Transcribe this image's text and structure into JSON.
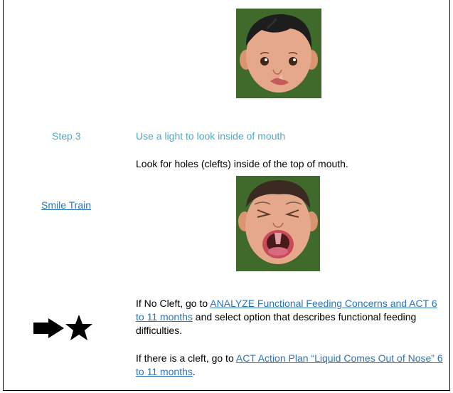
{
  "step": {
    "label": "Step 3",
    "instruction": "Use a light to look inside of mouth",
    "look_for": "Look for holes (clefts) inside of the top of mouth."
  },
  "link_smile_train": "Smile Train",
  "no_cleft": {
    "prefix": "If No Cleft, go to ",
    "link": "ANALYZE Functional Feeding Concerns and ACT 6 to 11 months",
    "suffix": " and select option that describes functional feeding difficulties."
  },
  "cleft": {
    "prefix": "If there is a cleft, go to ",
    "link": "ACT Action Plan “Liquid Comes Out of Nose” 6 to 11 months",
    "suffix": "."
  },
  "icons": [
    "arrow-icon",
    "star-icon"
  ],
  "colors": {
    "step_blue": "#4bacc6",
    "link_blue": "#2e74b5",
    "image_bg": "#3f6a2c"
  }
}
